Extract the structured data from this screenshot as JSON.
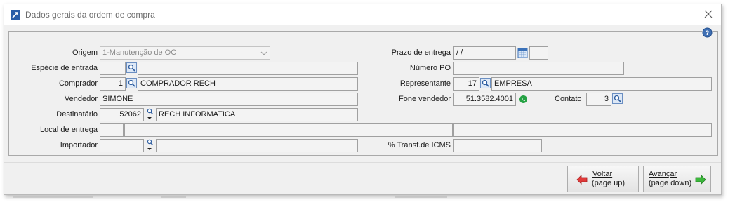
{
  "window": {
    "title": "Dados gerais da ordem de compra"
  },
  "fields": {
    "origem": {
      "label": "Origem",
      "value": "1-Manutenção de OC"
    },
    "especie": {
      "label": "Espécie de entrada",
      "value": ""
    },
    "comprador": {
      "label": "Comprador",
      "code": "1",
      "name": "COMPRADOR RECH"
    },
    "vendedor": {
      "label": "Vendedor",
      "value": "SIMONE"
    },
    "destinatario": {
      "label": "Destinatário",
      "code": "52062",
      "name": "RECH INFORMATICA"
    },
    "local_entrega": {
      "label": "Local de entrega",
      "value": ""
    },
    "importador": {
      "label": "Importador",
      "code": "",
      "name": ""
    },
    "prazo": {
      "label": "Prazo de entrega",
      "value": " / /"
    },
    "numero_po": {
      "label": "Número PO",
      "value": ""
    },
    "representante": {
      "label": "Representante",
      "code": "17",
      "name": "EMPRESA"
    },
    "fone": {
      "label": "Fone vendedor",
      "value": "51.3582.4001"
    },
    "contato": {
      "label": "Contato",
      "value": "3"
    },
    "icms": {
      "label": "% Transf.de ICMS",
      "value": ""
    }
  },
  "buttons": {
    "voltar": {
      "line1": "Voltar",
      "line2": "(page up)"
    },
    "avancar": {
      "line1": "Avançar",
      "line2": "(page down)"
    }
  },
  "colors": {
    "accent": "#2a5ea8",
    "back_arrow": "#e03a3a",
    "forward_arrow": "#3cb83c",
    "whatsapp": "#25a244"
  },
  "icons": [
    "app-icon",
    "close-icon",
    "help-icon",
    "lookup-icon",
    "key-icon",
    "calendar-icon",
    "whatsapp-icon",
    "back-arrow-icon",
    "forward-arrow-icon",
    "chevron-down-icon"
  ]
}
